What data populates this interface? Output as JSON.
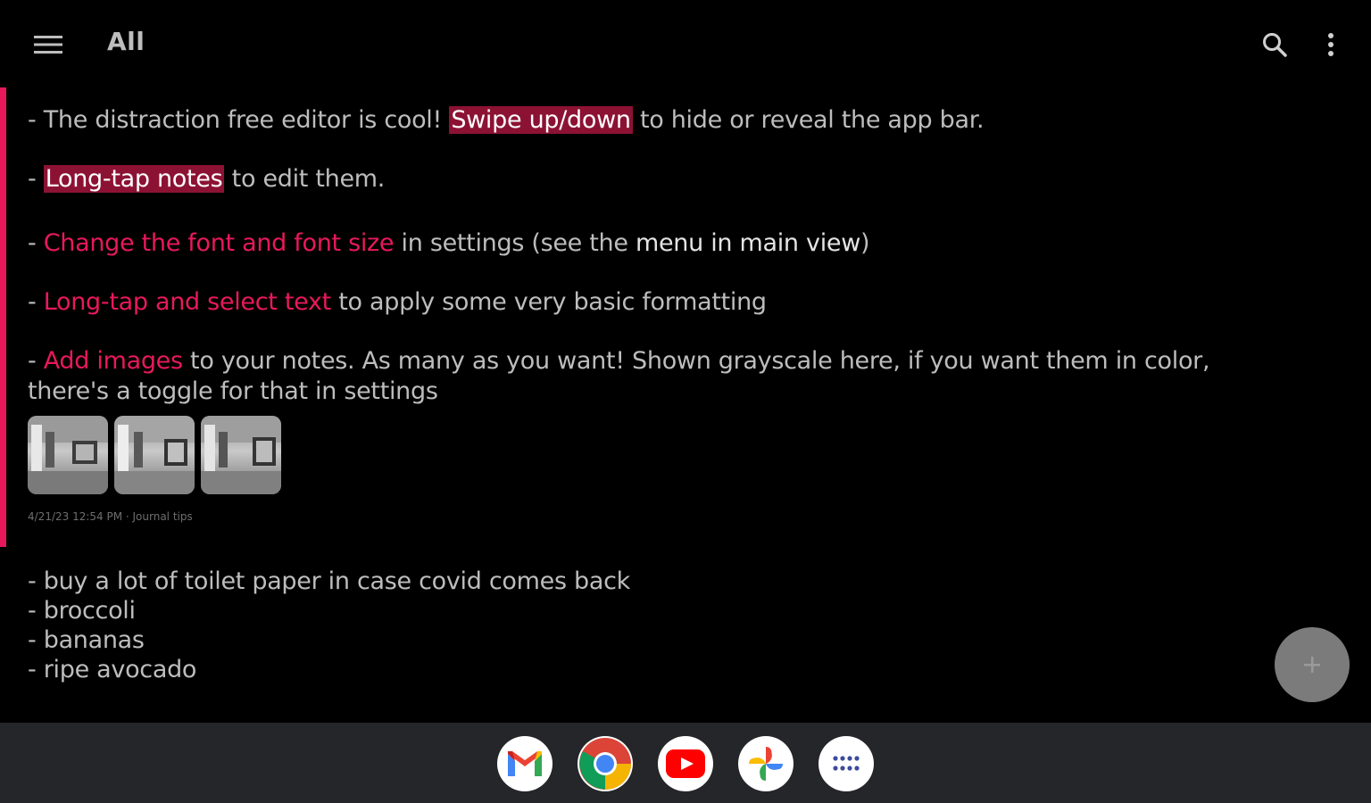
{
  "appbar": {
    "title": "All",
    "menu_icon": "hamburger-menu-icon",
    "search_icon": "search-icon",
    "more_icon": "more-vert-icon"
  },
  "note1": {
    "accent_color": "#e8195b",
    "tip1": {
      "prefix": "- The distraction free editor is cool! ",
      "highlight": "Swipe up/down",
      "suffix": " to hide or reveal the app bar."
    },
    "tip2": {
      "prefix": "- ",
      "highlight": "Long-tap notes",
      "suffix": " to edit them."
    },
    "tip3": {
      "prefix": "- ",
      "pink": "Change the font and font size",
      "middle": " in settings (see the ",
      "strong": "menu in main view",
      "suffix": ")"
    },
    "tip4": {
      "prefix": "- ",
      "pink": "Long-tap and select text",
      "suffix": " to apply some very basic formatting"
    },
    "tip5": {
      "prefix": "- ",
      "pink": "Add images",
      "suffix": " to your notes. As many as you want! Shown grayscale here, if you want them in color, there's a toggle for that in settings"
    },
    "images": [
      "image-thumbnail",
      "image-thumbnail",
      "image-thumbnail"
    ],
    "meta": "4/21/23 12:54 PM · Journal tips"
  },
  "note2": {
    "lines": [
      "- buy a lot of toilet paper in case covid comes back",
      "- broccoli",
      "- bananas",
      "- ripe avocado"
    ]
  },
  "fab": {
    "icon": "plus-icon"
  },
  "taskbar": {
    "apps": [
      "gmail-icon",
      "chrome-icon",
      "youtube-icon",
      "photos-icon",
      "app-drawer-icon"
    ]
  },
  "colors": {
    "background": "#000000",
    "accent": "#e8195b",
    "highlight_bg": "#8c1234",
    "taskbar": "#25262a",
    "fab": "#7b7b7b"
  }
}
